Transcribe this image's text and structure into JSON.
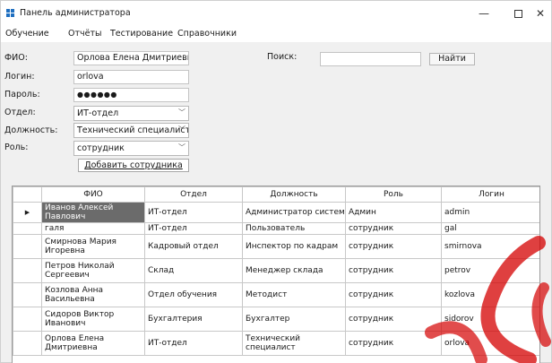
{
  "window": {
    "title": "Панель администратора",
    "minimize": "—",
    "maximize": "",
    "close": "✕"
  },
  "menu": [
    "Обучение",
    "Отчёты",
    "Тестирование",
    "Справочники"
  ],
  "form": {
    "fio_label": "ФИО:",
    "fio_value": "Орлова Елена Дмитриевна",
    "login_label": "Логин:",
    "login_value": "orlova",
    "password_label": "Пароль:",
    "password_value": "●●●●●●",
    "dept_label": "Отдел:",
    "dept_value": "ИТ-отдел",
    "position_label": "Должность:",
    "position_value": "Технический специалист",
    "role_label": "Роль:",
    "role_value": "сотрудник",
    "add_button": "Добавить сотрудника",
    "search_label": "Поиск:",
    "search_value": "",
    "find_button": "Найти"
  },
  "table": {
    "columns": [
      "ФИО",
      "Отдел",
      "Должность",
      "Роль",
      "Логин"
    ],
    "selected_marker": "▶",
    "rows": [
      [
        "Иванов Алексей Павлович",
        "ИТ-отдел",
        "Администратор систем",
        "Админ",
        "admin"
      ],
      [
        "галя",
        "ИТ-отдел",
        "Пользователь",
        "сотрудник",
        "gal"
      ],
      [
        "Смирнова Мария Игоревна",
        "Кадровый отдел",
        "Инспектор по кадрам",
        "сотрудник",
        "smirnova"
      ],
      [
        "Петров Николай Сергеевич",
        "Склад",
        "Менеджер склада",
        "сотрудник",
        "petrov"
      ],
      [
        "Козлова Анна Васильевна",
        "Отдел обучения",
        "Методист",
        "сотрудник",
        "kozlova"
      ],
      [
        "Сидоров Виктор Иванович",
        "Бухгалтерия",
        "Бухгалтер",
        "сотрудник",
        "sidorov"
      ],
      [
        "Орлова Елена Дмитриевна",
        "ИТ-отдел",
        "Технический специалист",
        "сотрудник",
        "orlova"
      ]
    ]
  },
  "colors": {
    "selection": "#6b6b6b",
    "watermark": "#d40000",
    "accent": "#1f6fc0"
  },
  "icons": {
    "app": "app-grid-icon",
    "watermark": "red-arc-watermark"
  }
}
